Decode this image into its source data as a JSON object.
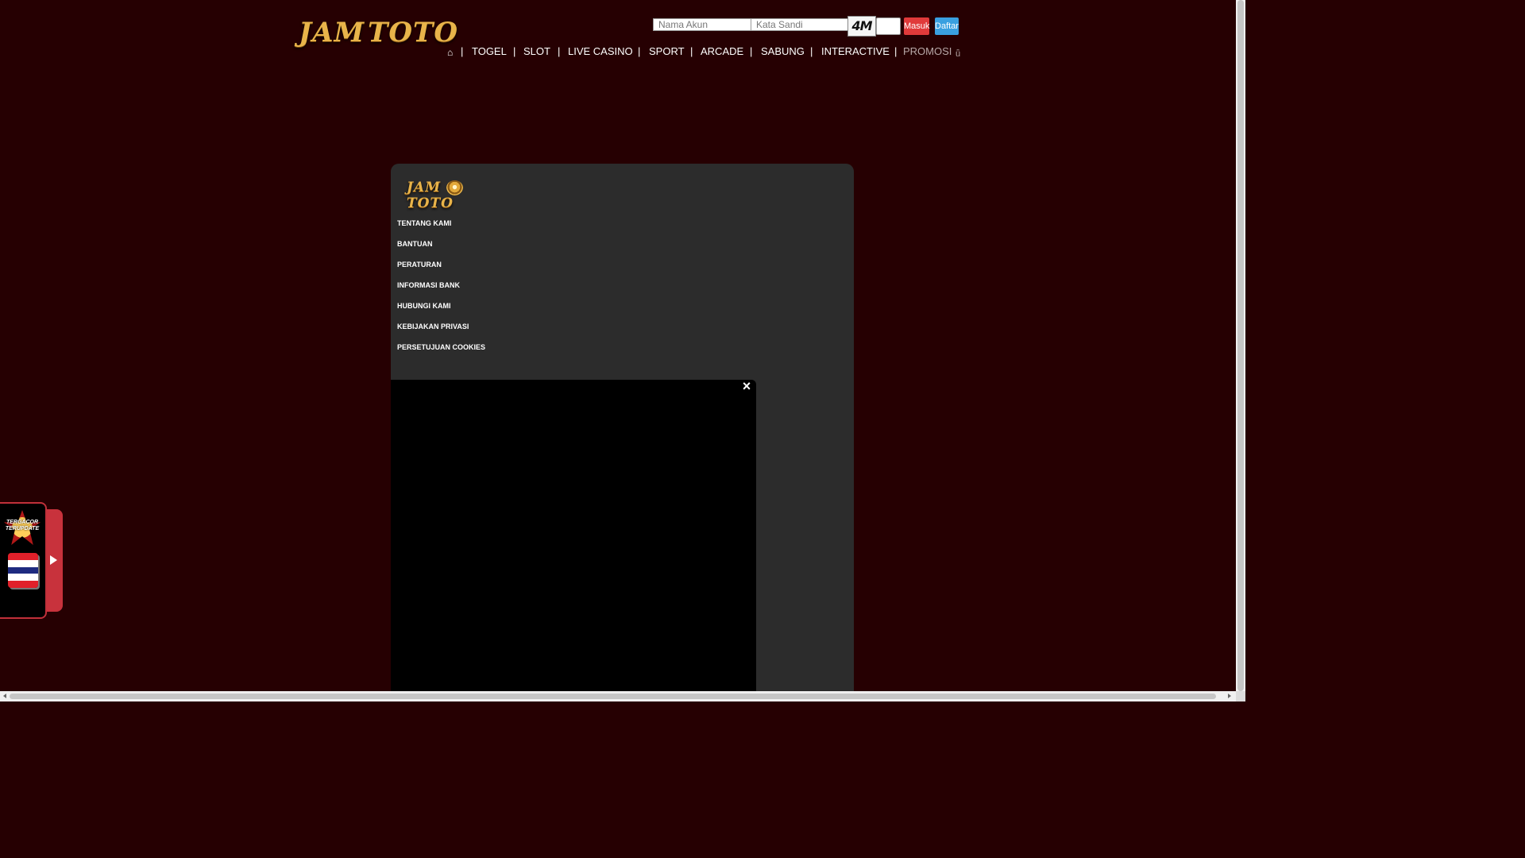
{
  "brand": {
    "logo_left": "JAM",
    "logo_right": "TOTO"
  },
  "login": {
    "username_placeholder": "Nama Akun",
    "password_placeholder": "Kata Sandi",
    "captcha_text": "4M",
    "login_label": "Masuk",
    "register_label": "Daftar"
  },
  "nav": {
    "home_icon": "home-icon",
    "items": [
      "TOGEL",
      "SLOT",
      "LIVE CASINO",
      "SPORT",
      "ARCADE",
      "SABUNG",
      "INTERACTIVE",
      "PROMOSI"
    ],
    "separator": "|"
  },
  "footer_menu": {
    "items": [
      "TENTANG KAMI",
      "BANTUAN",
      "PERATURAN",
      "INFORMASI BANK",
      "HUBUNGI KAMI",
      "KEBIJAKAN PRIVASI",
      "PERSETUJUAN COOKIES"
    ]
  },
  "video": {
    "close_label": "×"
  },
  "side_widget": {
    "badge_text": "TERGACOR TERUPDATE",
    "flag": "thailand-flag"
  },
  "colors": {
    "background": "#260002",
    "card": "#2c2c2c",
    "login_button": "#e03a3a",
    "register_button": "#3aa0e0",
    "logo_gold": "#e8b44a",
    "side_accent": "#c8323c"
  }
}
